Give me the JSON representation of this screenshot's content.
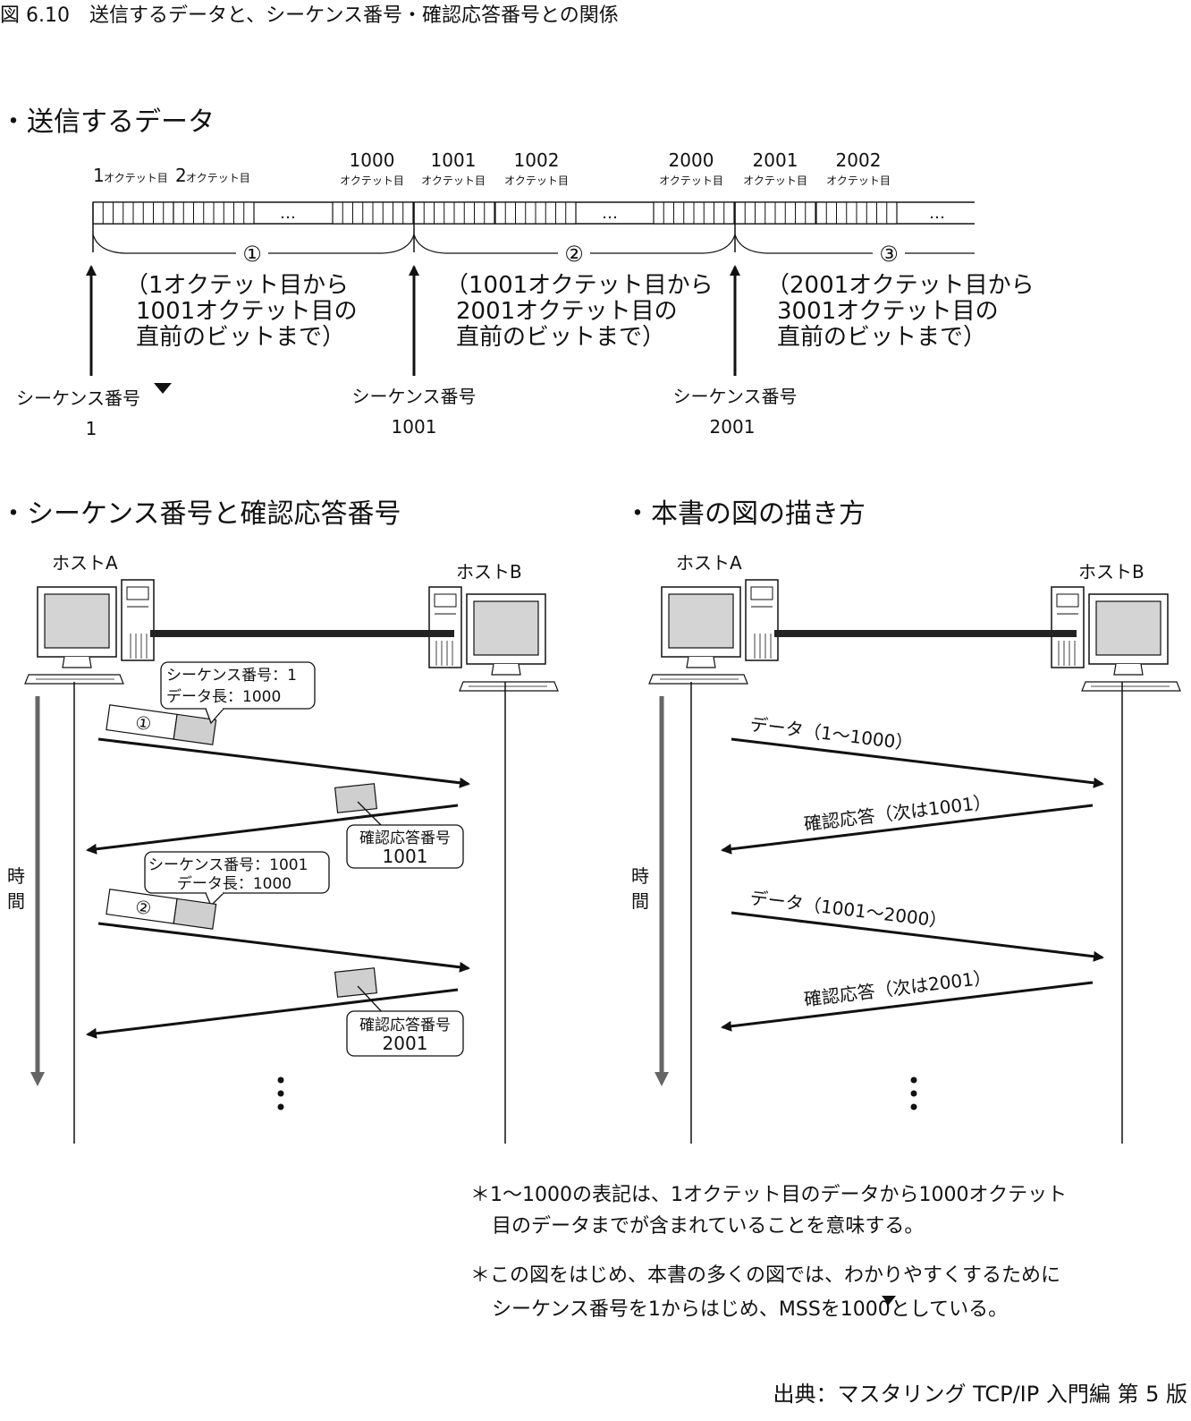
{
  "figure": {
    "caption": "図 6.10　送信するデータと、シーケンス番号・確認応答番号との関係",
    "source": "出典：マスタリング TCP/IP 入門編 第 5 版"
  },
  "data_section": {
    "heading": "・送信するデータ",
    "octet_labels": [
      {
        "num": "1",
        "text": "オクテット目"
      },
      {
        "num": "2",
        "text": "オクテット目"
      },
      {
        "num": "1000",
        "text": "オクテット目"
      },
      {
        "num": "1001",
        "text": "オクテット目"
      },
      {
        "num": "1002",
        "text": "オクテット目"
      },
      {
        "num": "2000",
        "text": "オクテット目"
      },
      {
        "num": "2001",
        "text": "オクテット目"
      },
      {
        "num": "2002",
        "text": "オクテット目"
      }
    ],
    "ellipsis": "…",
    "segments": [
      {
        "marker": "①",
        "desc": [
          "（1オクテット目から",
          "1001オクテット目の",
          "直前のビットまで）"
        ],
        "seq_label": "シーケンス番号",
        "seq_value": "1"
      },
      {
        "marker": "②",
        "desc": [
          "（1001オクテット目から",
          "2001オクテット目の",
          "直前のビットまで）"
        ],
        "seq_label": "シーケンス番号",
        "seq_value": "1001"
      },
      {
        "marker": "③",
        "desc": [
          "（2001オクテット目から",
          "3001オクテット目の",
          "直前のビットまで）"
        ],
        "seq_label": "シーケンス番号",
        "seq_value": "2001"
      }
    ]
  },
  "left_panel": {
    "heading": "・シーケンス番号と確認応答番号",
    "host_a": "ホストA",
    "host_b": "ホストB",
    "time_label": [
      "時",
      "間"
    ],
    "packets": [
      {
        "marker": "①",
        "callout": [
          "シーケンス番号：1",
          "データ長：1000"
        ]
      },
      {
        "marker": "②",
        "callout": [
          "シーケンス番号：1001",
          "データ長：1000"
        ]
      }
    ],
    "acks": [
      {
        "callout": [
          "確認応答番号",
          "1001"
        ]
      },
      {
        "callout": [
          "確認応答番号",
          "2001"
        ]
      }
    ]
  },
  "right_panel": {
    "heading": "・本書の図の描き方",
    "host_a": "ホストA",
    "host_b": "ホストB",
    "time_label": [
      "時",
      "間"
    ],
    "messages": [
      "データ（1〜1000）",
      "確認応答（次は1001）",
      "データ（1001〜2000）",
      "確認応答（次は2001）"
    ]
  },
  "notes": [
    [
      "＊1〜1000の表記は、1オクテット目のデータから1000オクテット",
      "目のデータまでが含まれていることを意味する。"
    ],
    [
      "＊この図をはじめ、本書の多くの図では、わかりやすくするために",
      "シーケンス番号を1からはじめ、MSSを1000としている。"
    ]
  ],
  "colors": {
    "line": "#111111",
    "packet_fill": "#cfcfcf",
    "screen_fill": "#d4d4d4",
    "time_arrow": "#666666"
  }
}
